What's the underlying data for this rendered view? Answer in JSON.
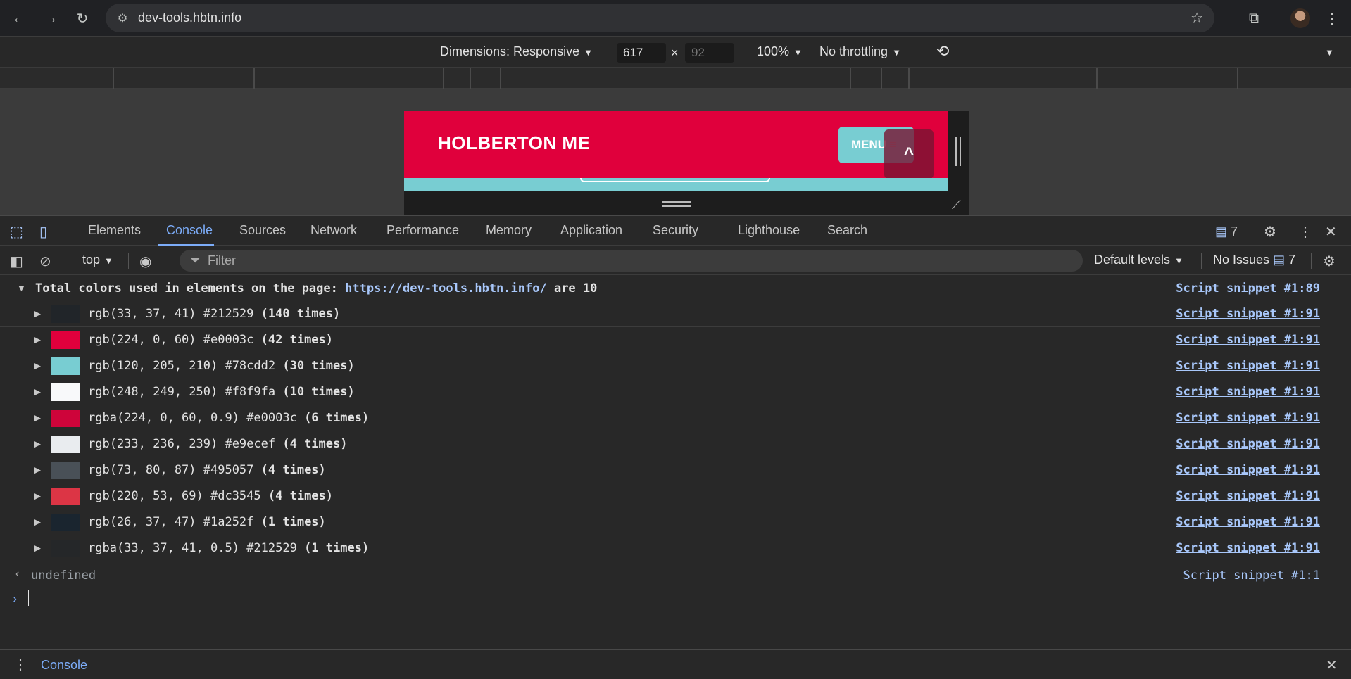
{
  "browser": {
    "url": "dev-tools.hbtn.info"
  },
  "device_toolbar": {
    "dimensions_label": "Dimensions: Responsive",
    "width": "617",
    "times": "×",
    "height": "92",
    "zoom": "100%",
    "throttling": "No throttling"
  },
  "page": {
    "title": "HOLBERTON ME",
    "menu_label": "MENU"
  },
  "devtools": {
    "tabs": [
      "Elements",
      "Console",
      "Sources",
      "Network",
      "Performance",
      "Memory",
      "Application",
      "Security",
      "Lighthouse",
      "Search"
    ],
    "issues_count": "7"
  },
  "console_bar": {
    "context": "top",
    "filter_placeholder": "Filter",
    "levels": "Default levels",
    "no_issues": "No Issues",
    "issues_count": "7"
  },
  "console": {
    "group": {
      "prefix": "Total colors used in elements on the page:",
      "link": "https://dev-tools.hbtn.info/",
      "suffix": "are 10",
      "source": "Script snippet #1:89"
    },
    "rows": [
      {
        "color": "#212529",
        "alpha": 1,
        "value": "rgb(33, 37, 41) #212529",
        "count": "(140 times)",
        "source": "Script snippet #1:91"
      },
      {
        "color": "#e0003c",
        "alpha": 1,
        "value": "rgb(224, 0, 60) #e0003c",
        "count": "(42 times)",
        "source": "Script snippet #1:91"
      },
      {
        "color": "#78cdd2",
        "alpha": 1,
        "value": "rgb(120, 205, 210) #78cdd2",
        "count": "(30 times)",
        "source": "Script snippet #1:91"
      },
      {
        "color": "#f8f9fa",
        "alpha": 1,
        "value": "rgb(248, 249, 250) #f8f9fa",
        "count": "(10 times)",
        "source": "Script snippet #1:91"
      },
      {
        "color": "#e0003c",
        "alpha": 0.9,
        "value": "rgba(224, 0, 60, 0.9) #e0003c",
        "count": "(6 times)",
        "source": "Script snippet #1:91"
      },
      {
        "color": "#e9ecef",
        "alpha": 1,
        "value": "rgb(233, 236, 239) #e9ecef",
        "count": "(4 times)",
        "source": "Script snippet #1:91"
      },
      {
        "color": "#495057",
        "alpha": 1,
        "value": "rgb(73, 80, 87) #495057",
        "count": "(4 times)",
        "source": "Script snippet #1:91"
      },
      {
        "color": "#dc3545",
        "alpha": 1,
        "value": "rgb(220, 53, 69) #dc3545",
        "count": "(4 times)",
        "source": "Script snippet #1:91"
      },
      {
        "color": "#1a252f",
        "alpha": 1,
        "value": "rgb(26, 37, 47) #1a252f",
        "count": "(1 times)",
        "source": "Script snippet #1:91"
      },
      {
        "color": "#212529",
        "alpha": 0.5,
        "value": "rgba(33, 37, 41, 0.5) #212529",
        "count": "(1 times)",
        "source": "Script snippet #1:91"
      }
    ],
    "result": "undefined",
    "result_source": "Script snippet #1:1"
  },
  "drawer": {
    "tab": "Console"
  }
}
